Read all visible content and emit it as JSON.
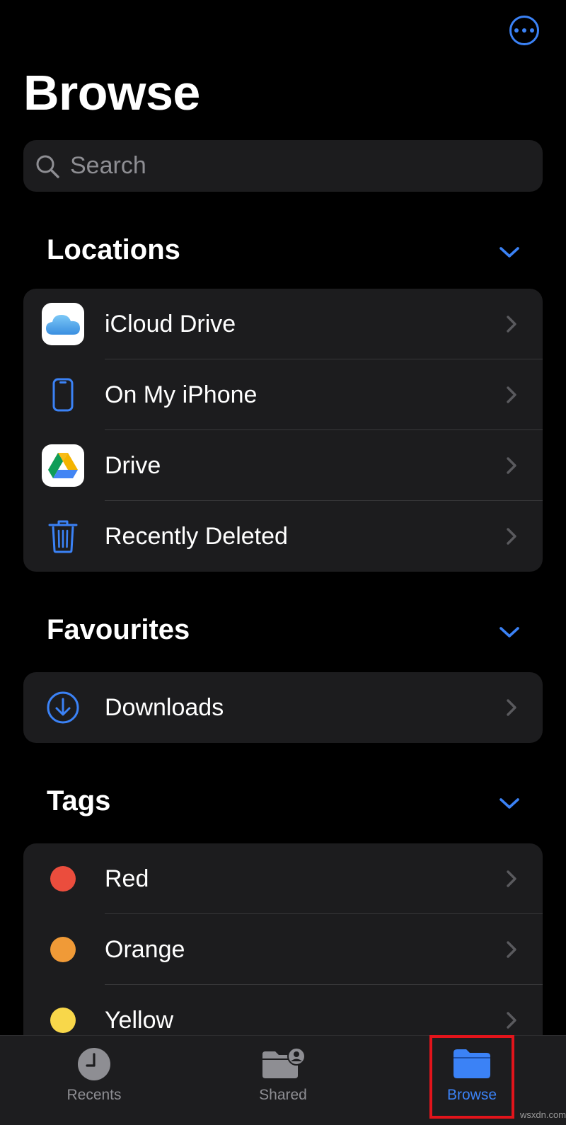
{
  "header": {
    "title": "Browse",
    "more_icon": "ellipsis-circle-icon"
  },
  "search": {
    "placeholder": "Search",
    "icon": "magnifier-icon"
  },
  "sections": {
    "locations": {
      "title": "Locations",
      "items": [
        {
          "label": "iCloud Drive",
          "icon": "icloud-icon"
        },
        {
          "label": "On My iPhone",
          "icon": "iphone-icon"
        },
        {
          "label": "Drive",
          "icon": "google-drive-icon"
        },
        {
          "label": "Recently Deleted",
          "icon": "trash-icon"
        }
      ]
    },
    "favourites": {
      "title": "Favourites",
      "items": [
        {
          "label": "Downloads",
          "icon": "download-circle-icon"
        }
      ]
    },
    "tags": {
      "title": "Tags",
      "items": [
        {
          "label": "Red",
          "color": "#eb4d3d"
        },
        {
          "label": "Orange",
          "color": "#f09a37"
        },
        {
          "label": "Yellow",
          "color": "#f8d74a"
        }
      ]
    }
  },
  "tabbar": {
    "tabs": [
      {
        "label": "Recents",
        "icon": "clock-icon",
        "active": false
      },
      {
        "label": "Shared",
        "icon": "shared-folder-icon",
        "active": false
      },
      {
        "label": "Browse",
        "icon": "folder-icon",
        "active": true
      }
    ]
  },
  "colors": {
    "accent": "#3b82f6",
    "background": "#000000",
    "group_background": "#1c1c1e",
    "highlight": "#e2141b"
  },
  "watermark": "wsxdn.com"
}
